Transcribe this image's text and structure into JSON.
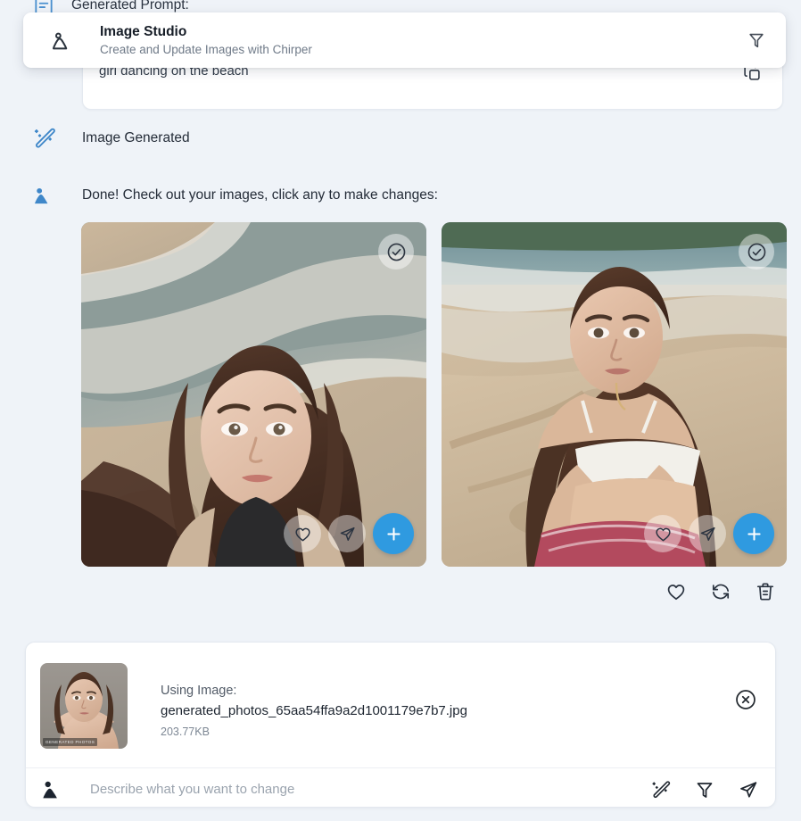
{
  "page": {
    "background_color": "#eff3f8",
    "accent_color": "#2f9ae0",
    "icon_blue": "#3f87c9"
  },
  "generated_prompt": {
    "label": "Generated Prompt:",
    "icon": "document-list-icon",
    "text": "girl dancing on the beach",
    "copy_icon": "copy-icon"
  },
  "studio_card": {
    "icon": "image-icon",
    "title": "Image Studio",
    "subtitle": "Create and Update Images with Chirper",
    "action_icon": "funnel-icon"
  },
  "messages": [
    {
      "icon": "magic-wand-icon",
      "text": "Image Generated"
    },
    {
      "icon": "image-icon",
      "text": "Done! Check out your images, click any to make changes:"
    }
  ],
  "results": {
    "images": [
      {
        "alt": "Generated image 1 - woman on beach in black top",
        "select_icon": "check-circle-icon",
        "actions": [
          {
            "icon": "heart-icon",
            "label": "Favorite"
          },
          {
            "icon": "send-icon",
            "label": "Send"
          },
          {
            "icon": "plus-icon",
            "label": "Add"
          }
        ]
      },
      {
        "alt": "Generated image 2 - woman on beach in white top",
        "select_icon": "check-circle-icon",
        "actions": [
          {
            "icon": "heart-icon",
            "label": "Favorite"
          },
          {
            "icon": "send-icon",
            "label": "Send"
          },
          {
            "icon": "plus-icon",
            "label": "Add"
          }
        ]
      }
    ],
    "toolbar": [
      {
        "icon": "heart-icon",
        "label": "Favorite"
      },
      {
        "icon": "refresh-icon",
        "label": "Regenerate"
      },
      {
        "icon": "trash-icon",
        "label": "Delete"
      }
    ]
  },
  "composer": {
    "attachment": {
      "label": "Using Image:",
      "filename": "generated_photos_65aa54ffa9a2d1001179e7b7.jpg",
      "filesize": "203.77KB",
      "watermark": "GENERATED PHOTOS",
      "remove_icon": "close-circle-icon"
    },
    "avatar_icon": "user-image-icon",
    "input": {
      "value": "",
      "placeholder": "Describe what you want to change"
    },
    "tools": [
      {
        "icon": "magic-wand-icon",
        "label": "Enhance"
      },
      {
        "icon": "funnel-icon",
        "label": "Style"
      },
      {
        "icon": "send-icon",
        "label": "Send"
      }
    ]
  }
}
